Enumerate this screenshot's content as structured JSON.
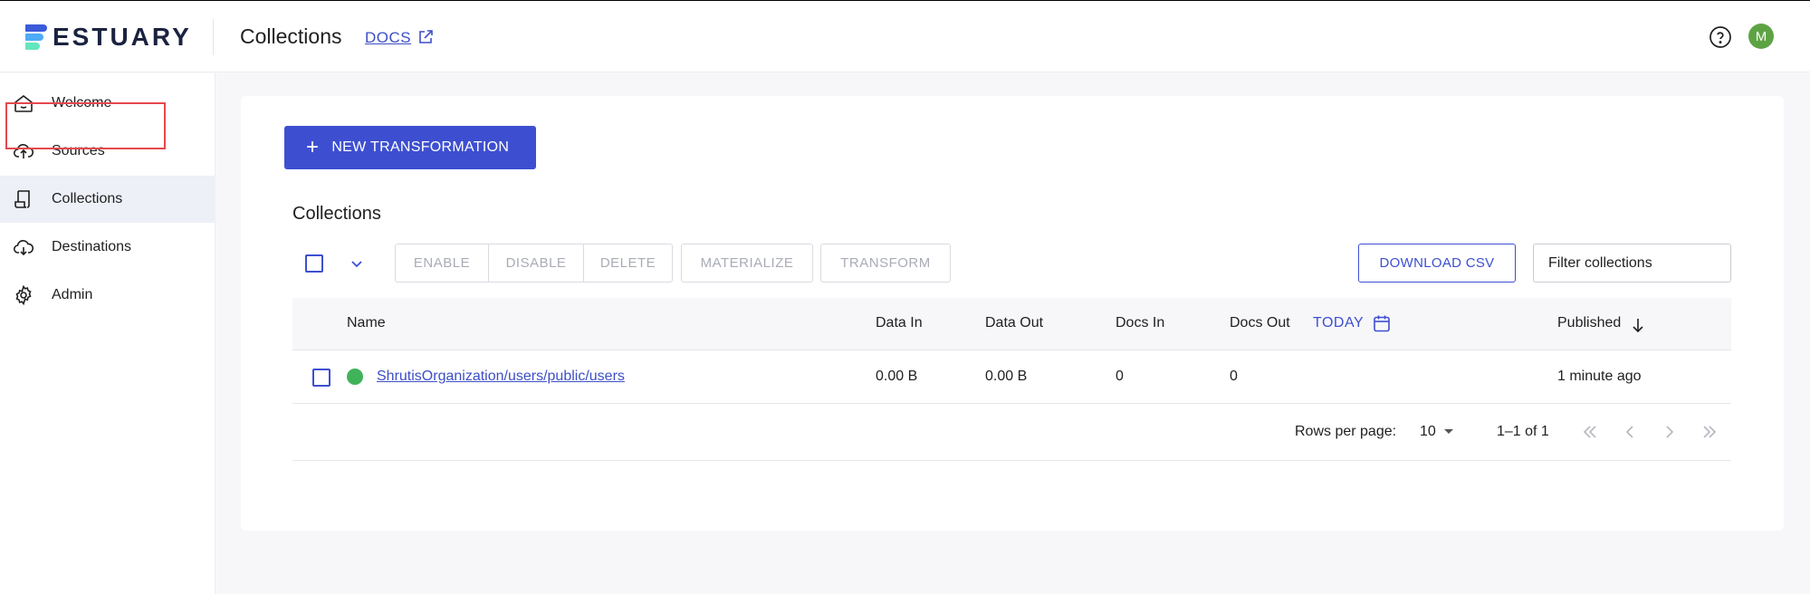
{
  "header": {
    "brand": "ESTUARY",
    "title": "Collections",
    "docs_label": "DOCS",
    "avatar_initial": "M"
  },
  "sidebar": {
    "items": [
      {
        "label": "Welcome",
        "icon": "home-icon"
      },
      {
        "label": "Sources",
        "icon": "cloud-upload-icon"
      },
      {
        "label": "Collections",
        "icon": "collections-icon",
        "active": true
      },
      {
        "label": "Destinations",
        "icon": "cloud-download-icon"
      },
      {
        "label": "Admin",
        "icon": "gear-icon"
      }
    ]
  },
  "main": {
    "new_button": "NEW TRANSFORMATION",
    "section_title": "Collections",
    "actions": [
      "ENABLE",
      "DISABLE",
      "DELETE"
    ],
    "materialize": "MATERIALIZE",
    "transform": "TRANSFORM",
    "download_csv": "DOWNLOAD CSV",
    "filter_placeholder": "Filter collections"
  },
  "table": {
    "columns": {
      "name": "Name",
      "data_in": "Data In",
      "data_out": "Data Out",
      "docs_in": "Docs In",
      "docs_out": "Docs Out",
      "today": "TODAY",
      "published": "Published"
    },
    "rows": [
      {
        "name": "ShrutisOrganization/users/public/users",
        "data_in": "0.00 B",
        "data_out": "0.00 B",
        "docs_in": "0",
        "docs_out": "0",
        "published": "1 minute ago"
      }
    ]
  },
  "pagination": {
    "rows_per_page_label": "Rows per page:",
    "rows_per_page": "10",
    "range": "1–1 of 1"
  },
  "colors": {
    "accent": "#3d4fd0",
    "status_ok": "#40b35a",
    "highlight_box": "#e5484d",
    "avatar": "#5ea343"
  }
}
